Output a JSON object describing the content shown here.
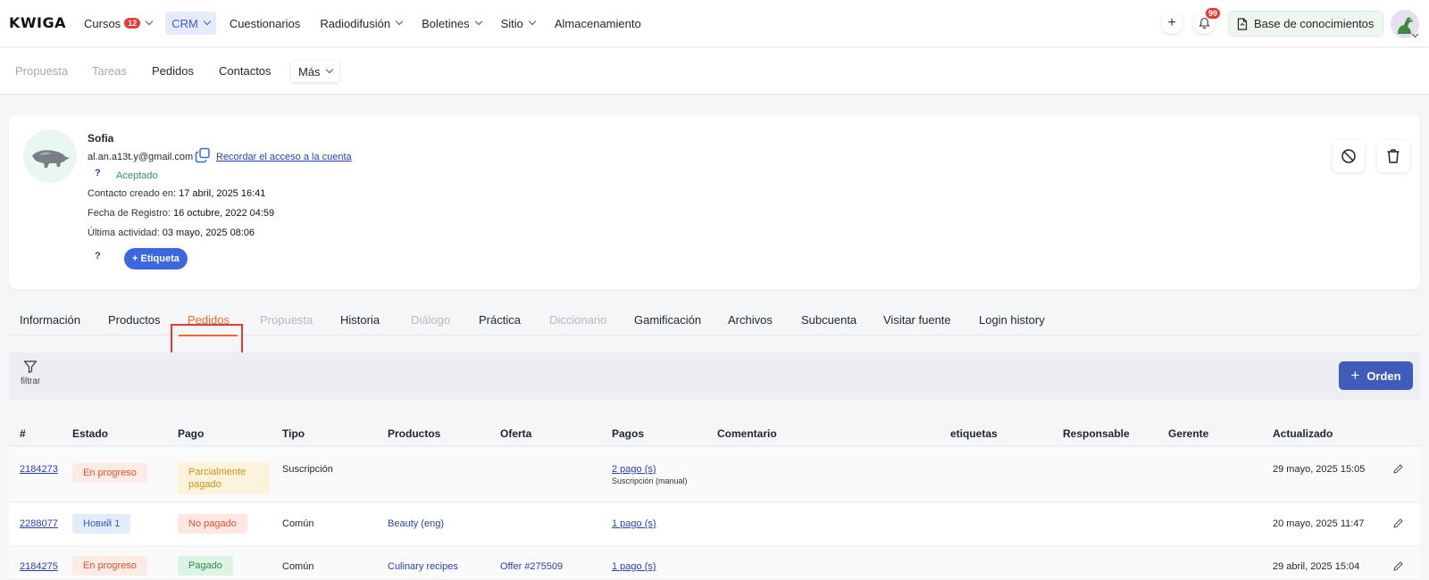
{
  "app": {
    "logo": "KWIGA"
  },
  "nav": {
    "items": [
      {
        "label": "Cursos",
        "badge": "12",
        "dropdown": true,
        "active": false
      },
      {
        "label": "CRM",
        "dropdown": true,
        "active": true
      },
      {
        "label": "Cuestionarios",
        "dropdown": false,
        "active": false
      },
      {
        "label": "Radiodifusión",
        "dropdown": true,
        "active": false
      },
      {
        "label": "Boletines",
        "dropdown": true,
        "active": false
      },
      {
        "label": "Sitio",
        "dropdown": true,
        "active": false
      },
      {
        "label": "Almacenamiento",
        "dropdown": false,
        "active": false
      }
    ],
    "add_icon": "plus-icon",
    "notifications_badge": "99",
    "knowledge_base": "Base de conocimientos"
  },
  "subnav": {
    "items": [
      {
        "label": "Propuesta",
        "muted": true
      },
      {
        "label": "Tareas",
        "muted": true
      },
      {
        "label": "Pedidos",
        "muted": false
      },
      {
        "label": "Contactos",
        "muted": false
      }
    ],
    "more": "Más"
  },
  "profile": {
    "name": "Sofia",
    "email": "al.an.a13t.y@gmail.com",
    "reminder_link": "Recordar el acceso a la cuenta",
    "help_mark": "?",
    "status": "Aceptado",
    "created_label": "Contacto creado en:",
    "created_value": "17 abril, 2025 16:41",
    "registered_label": "Fecha de Registro:",
    "registered_value": "16 octubre, 2022 04:59",
    "last_activity_label": "Última actividad:",
    "last_activity_value": "03 mayo, 2025 08:06",
    "tag_button": "+ Etiqueta"
  },
  "tabs": [
    {
      "label": "Información",
      "state": "normal"
    },
    {
      "label": "Productos",
      "state": "normal"
    },
    {
      "label": "Pedidos",
      "state": "active"
    },
    {
      "label": "Propuesta",
      "state": "disabled"
    },
    {
      "label": "Historia",
      "state": "normal"
    },
    {
      "label": "Diálogo",
      "state": "disabled"
    },
    {
      "label": "Práctica",
      "state": "normal"
    },
    {
      "label": "Diccionario",
      "state": "disabled"
    },
    {
      "label": "Gamificación",
      "state": "normal"
    },
    {
      "label": "Archivos",
      "state": "normal"
    },
    {
      "label": "Subcuenta",
      "state": "normal"
    },
    {
      "label": "Visitar fuente",
      "state": "normal"
    },
    {
      "label": "Login history",
      "state": "normal"
    }
  ],
  "toolbar": {
    "filter_label": "filtrar",
    "order_button": "Orden"
  },
  "table": {
    "columns": [
      "#",
      "Estado",
      "Pago",
      "Tipo",
      "Productos",
      "Oferta",
      "Pagos",
      "Comentario",
      "etiquetas",
      "Responsable",
      "Gerente",
      "Actualizado"
    ],
    "rows": [
      {
        "id": "2184273",
        "status": "En progreso",
        "status_kind": "progress",
        "payment": "Parcialmente pagado",
        "payment_kind": "partial",
        "type": "Suscripción",
        "products": "",
        "offer": "",
        "payments": "2 pago (s)",
        "payments_note": "Suscripción (manual)",
        "updated": "29 mayo, 2025 15:05"
      },
      {
        "id": "2288077",
        "status": "Новий 1",
        "status_kind": "new",
        "payment": "No pagado",
        "payment_kind": "unpaid",
        "type": "Común",
        "products": "Beauty (eng)",
        "offer": "",
        "payments": "1 pago (s)",
        "payments_note": "",
        "updated": "20 mayo, 2025 11:47"
      },
      {
        "id": "2184275",
        "status": "En progreso",
        "status_kind": "progress",
        "payment": "Pagado",
        "payment_kind": "paid",
        "type": "Común",
        "products": "Culinary recipes",
        "offer": "Offer #275509",
        "payments": "1 pago (s)",
        "payments_note": "",
        "updated": "29 abril, 2025 15:04"
      }
    ]
  },
  "colors": {
    "accent": "#3d67e0",
    "active_tab": "#f06a2b",
    "highlight": "#e53935"
  }
}
